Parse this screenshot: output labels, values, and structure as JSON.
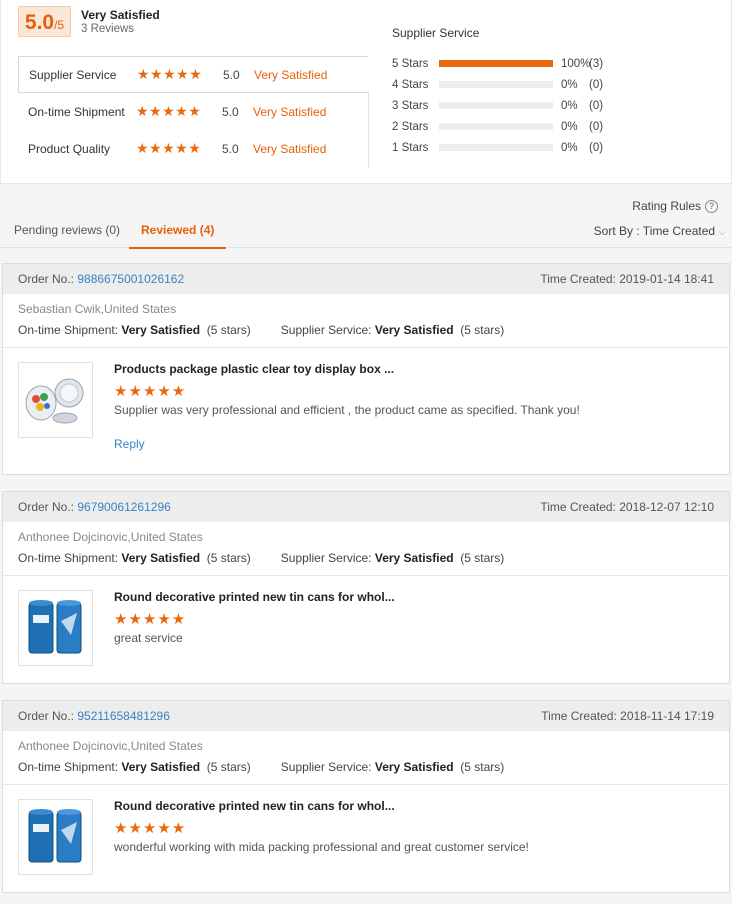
{
  "summary": {
    "score": "5.0",
    "score_suffix": "/5",
    "title": "Very Satisfied",
    "reviews_count": "3 Reviews",
    "metrics": [
      {
        "label": "Supplier Service",
        "stars": "★★★★★",
        "value": "5.0",
        "desc": "Very Satisfied"
      },
      {
        "label": "On-time Shipment",
        "stars": "★★★★★",
        "value": "5.0",
        "desc": "Very Satisfied"
      },
      {
        "label": "Product Quality",
        "stars": "★★★★★",
        "value": "5.0",
        "desc": "Very Satisfied"
      }
    ],
    "distribution": {
      "title": "Supplier Service",
      "rows": [
        {
          "label": "5 Stars",
          "percent": "100%",
          "count": "(3)",
          "fraction": 1
        },
        {
          "label": "4 Stars",
          "percent": "0%",
          "count": "(0)",
          "fraction": 0
        },
        {
          "label": "3 Stars",
          "percent": "0%",
          "count": "(0)",
          "fraction": 0
        },
        {
          "label": "2 Stars",
          "percent": "0%",
          "count": "(0)",
          "fraction": 0
        },
        {
          "label": "1 Stars",
          "percent": "0%",
          "count": "(0)",
          "fraction": 0
        }
      ]
    }
  },
  "controls": {
    "rating_rules": "Rating Rules",
    "help_icon": "?",
    "tab_pending": "Pending reviews (0)",
    "tab_reviewed": "Reviewed (4)",
    "sort_label": "Sort By : Time Created",
    "sort_caret": "⌵"
  },
  "labels": {
    "order_no": "Order No.:",
    "time_created": "Time Created:",
    "ontime": "On-time Shipment:",
    "supplier": "Supplier Service:",
    "reply": "Reply"
  },
  "reviews": [
    {
      "order_no": "9886675001026162",
      "time": "2019-01-14 18:41",
      "buyer": "Sebastian Cwik,United States",
      "ontime_value": "Very Satisfied",
      "ontime_stars": "(5 stars)",
      "supplier_value": "Very Satisfied",
      "supplier_stars": "(5 stars)",
      "product_title": "Products package plastic clear toy display box ...",
      "stars": "★★★★★",
      "comment": "Supplier was very professional and efficient , the product came as specified. Thank you!",
      "thumb_icon": "clear-container-thumbnail"
    },
    {
      "order_no": "96790061261296",
      "time": "2018-12-07 12:10",
      "buyer": "Anthonee Dojcinovic,United States",
      "ontime_value": "Very Satisfied",
      "ontime_stars": "(5 stars)",
      "supplier_value": "Very Satisfied",
      "supplier_stars": "(5 stars)",
      "product_title": "Round decorative printed new tin cans for whol...",
      "stars": "★★★★★",
      "comment": "great service",
      "thumb_icon": "blue-tin-can-thumbnail"
    },
    {
      "order_no": "95211658481296",
      "time": "2018-11-14 17:19",
      "buyer": "Anthonee Dojcinovic,United States",
      "ontime_value": "Very Satisfied",
      "ontime_stars": "(5 stars)",
      "supplier_value": "Very Satisfied",
      "supplier_stars": "(5 stars)",
      "product_title": "Round decorative printed new tin cans for whol...",
      "stars": "★★★★★",
      "comment": "wonderful working with mida packing professional and great customer service!",
      "thumb_icon": "blue-tin-can-thumbnail"
    }
  ]
}
